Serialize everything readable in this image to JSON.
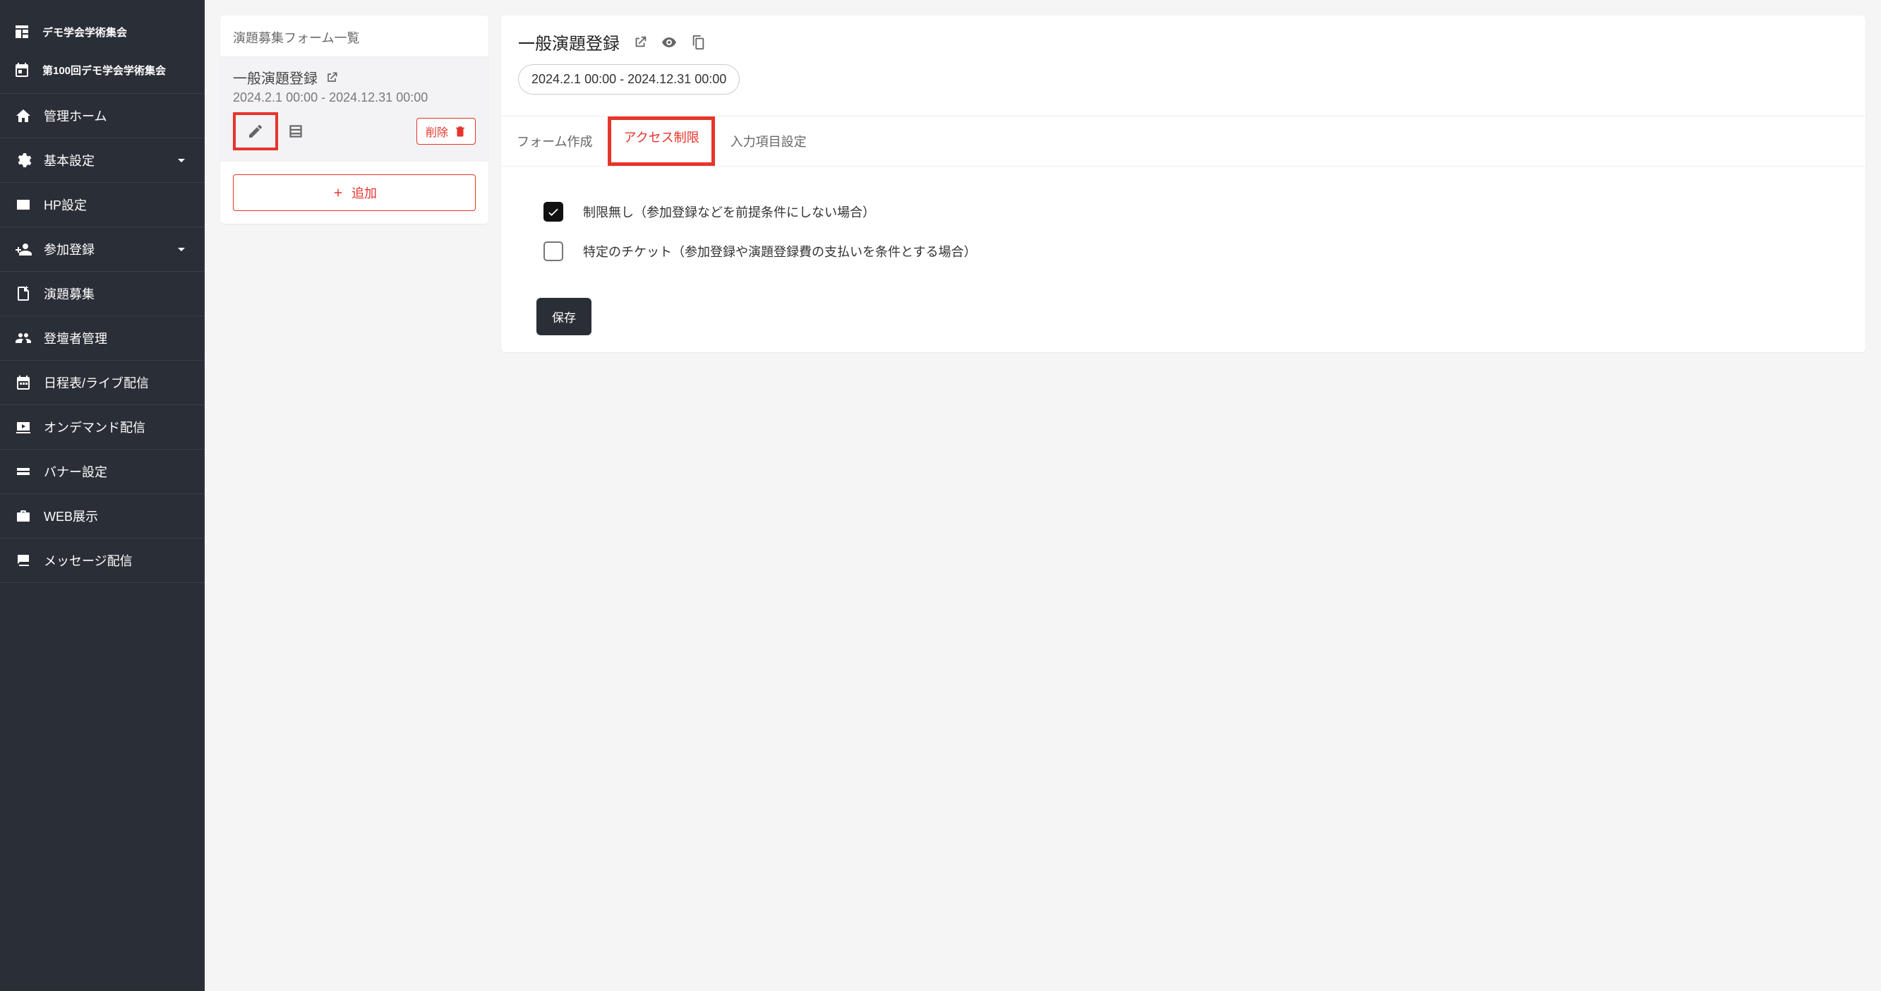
{
  "sidebar": {
    "org_label": "デモ学会学術集会",
    "event_label": "第100回デモ学会学術集会",
    "items": [
      {
        "label": "管理ホーム"
      },
      {
        "label": "基本設定",
        "expandable": true
      },
      {
        "label": "HP設定"
      },
      {
        "label": "参加登録",
        "expandable": true
      },
      {
        "label": "演題募集"
      },
      {
        "label": "登壇者管理"
      },
      {
        "label": "日程表/ライブ配信"
      },
      {
        "label": "オンデマンド配信"
      },
      {
        "label": "バナー設定"
      },
      {
        "label": "WEB展示"
      },
      {
        "label": "メッセージ配信"
      }
    ]
  },
  "form_list": {
    "heading": "演題募集フォーム一覧",
    "items": [
      {
        "title": "一般演題登録",
        "date_range": "2024.2.1 00:00 - 2024.12.31 00:00"
      }
    ],
    "delete_label": "削除",
    "add_label": "追加"
  },
  "detail": {
    "title": "一般演題登録",
    "date_range": "2024.2.1 00:00 - 2024.12.31 00:00",
    "tabs": [
      {
        "label": "フォーム作成"
      },
      {
        "label": "アクセス制限",
        "active": true
      },
      {
        "label": "入力項目設定"
      }
    ],
    "access": {
      "option_none": "制限無し（参加登録などを前提条件にしない場合）",
      "option_ticket": "特定のチケット（参加登録や演題登録費の支払いを条件とする場合）"
    },
    "save_label": "保存"
  }
}
